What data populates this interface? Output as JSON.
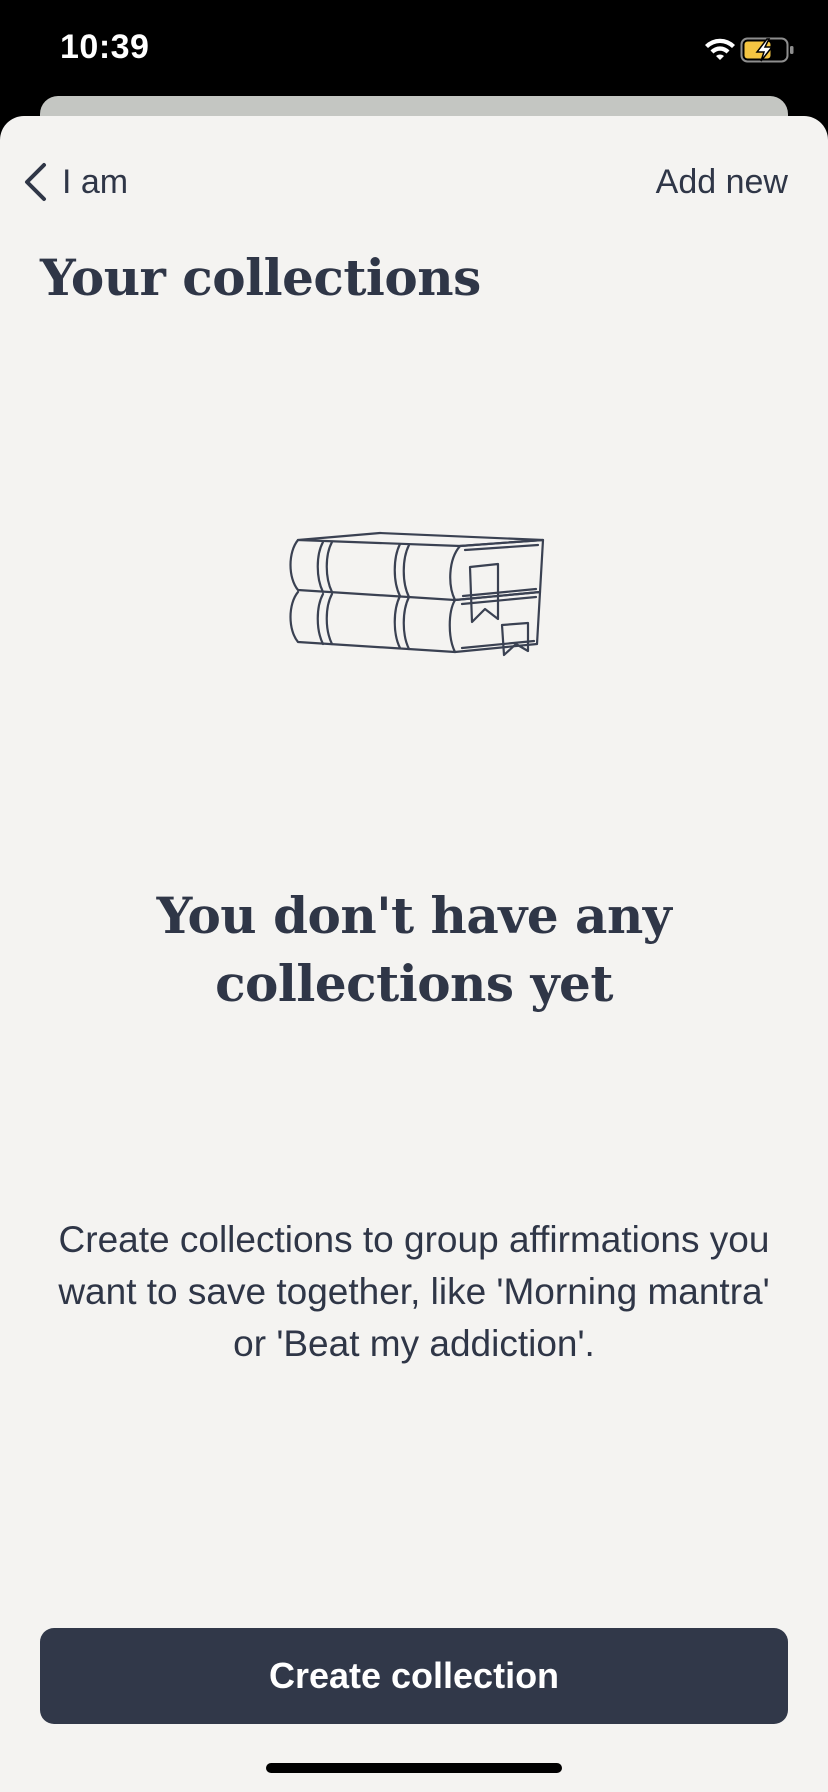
{
  "status_bar": {
    "time": "10:39",
    "icons": [
      "wifi-icon",
      "battery-charging-icon"
    ],
    "battery_color": "#f5c542"
  },
  "nav": {
    "back_label": "I am",
    "back_icon": "chevron-left-icon",
    "add_label": "Add new"
  },
  "page": {
    "title": "Your collections"
  },
  "empty_state": {
    "illustration": "stacked-books-icon",
    "heading": "You don't have any collections yet",
    "body": "Create collections to group affirmations you want to save together, like 'Morning mantra' or 'Beat my addiction'."
  },
  "actions": {
    "create_label": "Create collection"
  },
  "colors": {
    "background": "#f4f3f1",
    "text": "#2f3647",
    "button": "#313849",
    "button_text": "#ffffff"
  }
}
